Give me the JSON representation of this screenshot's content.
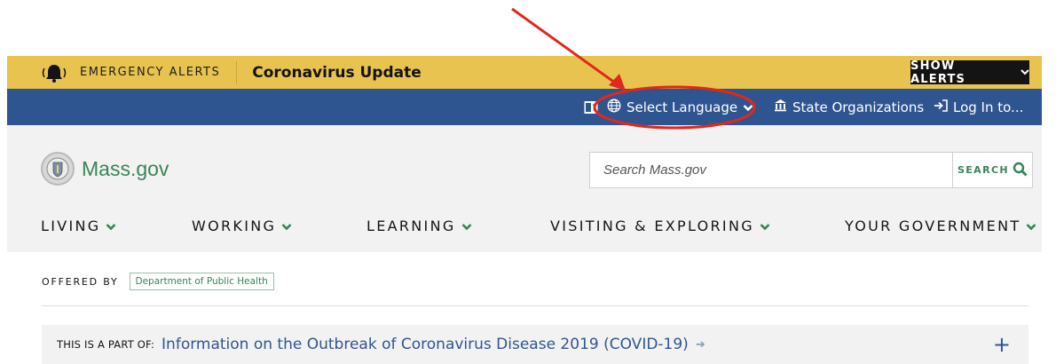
{
  "alerts": {
    "label": "EMERGENCY ALERTS",
    "title": "Coronavirus Update",
    "show_button": "SHOW ALERTS",
    "icon": "bell-icon"
  },
  "utility_nav": {
    "language": "Select Language",
    "organizations": "State Organizations",
    "login": "Log In to...",
    "icons": [
      "translate-icon",
      "globe-icon",
      "building-icon",
      "login-icon"
    ]
  },
  "header": {
    "logo_text": "Mass.gov",
    "search_placeholder": "Search Mass.gov",
    "search_button": "SEARCH"
  },
  "main_nav": {
    "items": [
      "LIVING",
      "WORKING",
      "LEARNING",
      "VISITING & EXPLORING",
      "YOUR GOVERNMENT"
    ]
  },
  "offered_by": {
    "label": "OFFERED BY",
    "org": "Department of Public Health"
  },
  "part_of": {
    "label": "THIS IS A PART OF:",
    "link": "Information on the Outbreak of Coronavirus Disease 2019 (COVID-19)",
    "expand": "+"
  },
  "colors": {
    "alert_bar": "#e9c34f",
    "utility_bar": "#2f5590",
    "brand_green": "#388557",
    "link_blue": "#2f5590",
    "annotation_red": "#e0281c"
  }
}
